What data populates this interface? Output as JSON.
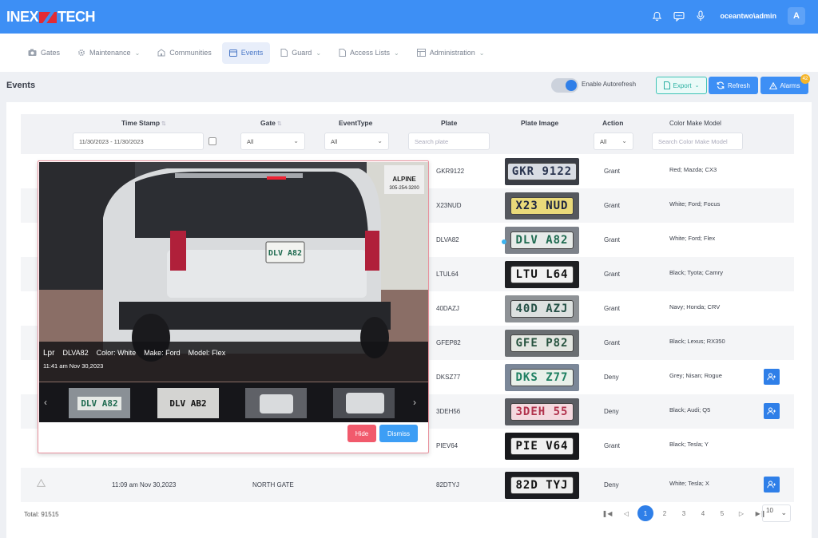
{
  "app": {
    "logo": "INEX TECH",
    "user": "oceantwo\\admin",
    "avatar_letter": "A"
  },
  "nav": [
    {
      "label": "Gates",
      "icon": "camera-icon"
    },
    {
      "label": "Maintenance",
      "icon": "gear-icon"
    },
    {
      "label": "Communities",
      "icon": "building-icon"
    },
    {
      "label": "Events",
      "icon": "calendar-icon"
    },
    {
      "label": "Guard",
      "icon": "document-icon"
    },
    {
      "label": "Access Lists",
      "icon": "document-icon"
    },
    {
      "label": "Administration",
      "icon": "table-icon"
    }
  ],
  "page": {
    "title": "Events",
    "autorefresh_label": "Enable Autorefresh",
    "export_label": "Export",
    "refresh_label": "Refresh",
    "alarms_label": "Alarms",
    "alarms_count": "42"
  },
  "columns": {
    "timestamp": "Time Stamp",
    "gate": "Gate",
    "eventtype": "EventType",
    "plate": "Plate",
    "plate_image": "Plate Image",
    "action": "Action",
    "cmm": "Color Make Model"
  },
  "filters": {
    "date_range": "11/30/2023 - 11/30/2023",
    "gate": "All",
    "eventtype": "All",
    "plate_placeholder": "Search plate",
    "action": "All",
    "cmm_placeholder": "Search Color Make Model"
  },
  "rows": [
    {
      "plate": "GKR9122",
      "plate_img": "GKR 9122",
      "action": "Grant",
      "cmm": "Red; Mazda; CX3"
    },
    {
      "plate": "X23NUD",
      "plate_img": "X23 NUD",
      "action": "Grant",
      "cmm": "White; Ford; Focus"
    },
    {
      "plate": "DLVA82",
      "plate_img": "DLV A82",
      "action": "Grant",
      "cmm": "White; Ford; Flex"
    },
    {
      "plate": "LTUL64",
      "plate_img": "LTU L64",
      "action": "Grant",
      "cmm": "Black; Tyota; Camry"
    },
    {
      "plate": "40DAZJ",
      "plate_img": "40D AZJ",
      "action": "Grant",
      "cmm": "Navy; Honda; CRV"
    },
    {
      "plate": "GFEP82",
      "plate_img": "GFE P82",
      "action": "Grant",
      "cmm": "Black; Lexus; RX350"
    },
    {
      "plate": "DKSZ77",
      "plate_img": "DKS Z77",
      "action": "Deny",
      "cmm": "Grey; Nisan; Rogue"
    },
    {
      "plate": "3DEH56",
      "plate_img": "3DEH 55",
      "action": "Deny",
      "cmm": "Black; Audi; Q5"
    },
    {
      "plate": "PIEV64",
      "plate_img": "PIE V64",
      "action": "Grant",
      "cmm": "Black; Tesla; Y"
    },
    {
      "plate": "82DTYJ",
      "plate_img": "82D TYJ",
      "action": "Deny",
      "cmm": "White; Tesla; X",
      "timestamp": "11:09 am Nov 30,2023",
      "gate": "NORTH GATE"
    }
  ],
  "popup": {
    "lpr_label": "Lpr",
    "plate": "DLVA82",
    "color": "Color: White",
    "make": "Make: Ford",
    "model": "Model: Flex",
    "time": "11:41 am Nov 30,2023",
    "rear_plate": "DLV A82",
    "sign_name": "ALPINE",
    "sign_number": "305-254-3200",
    "thumb_plate_1": "DLV A82",
    "thumb_plate_2": "DLV AB2",
    "hide_label": "Hide",
    "dismiss_label": "Dismiss"
  },
  "footer": {
    "total": "Total: 91515",
    "pages": [
      "1",
      "2",
      "3",
      "4",
      "5"
    ],
    "page_size": "10"
  },
  "colors": {
    "primary": "#3d8ff5",
    "brand_red": "#e22b34",
    "hide": "#f15a6c",
    "export": "#2bb0a2"
  }
}
